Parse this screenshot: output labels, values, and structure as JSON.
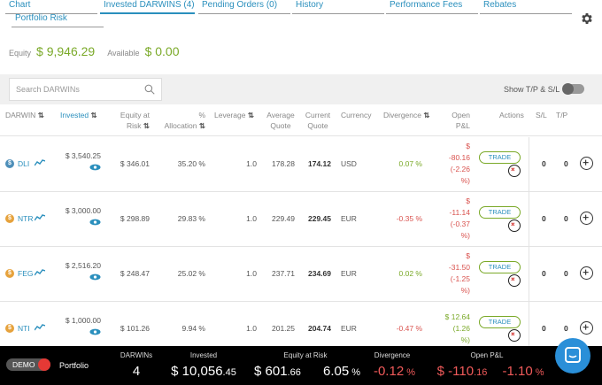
{
  "tabs": [
    {
      "label": "Chart"
    },
    {
      "label": "Invested DARWINS (4)"
    },
    {
      "label": "Pending Orders (0)"
    },
    {
      "label": "History"
    },
    {
      "label": "Performance Fees"
    },
    {
      "label": "Rebates"
    },
    {
      "label": "Portfolio Risk"
    }
  ],
  "active_tab": "Invested DARWINS (4)",
  "summary": {
    "equity_label": "Equity",
    "equity_value": "$ 9,946.29",
    "available_label": "Available",
    "available_value": "$ 0.00"
  },
  "search": {
    "placeholder": "Search DARWINs"
  },
  "show_tp_sl": {
    "label": "Show T/P & S/L",
    "enabled": false
  },
  "columns": {
    "darwin": "DARWIN",
    "invested": "Invested",
    "equity_at_risk_1": "Equity at",
    "equity_at_risk_2": "Risk",
    "alloc_1": "%",
    "alloc_2": "Allocation",
    "leverage": "Leverage",
    "avg_1": "Average",
    "avg_2": "Quote",
    "cur_1": "Current",
    "cur_2": "Quote",
    "currency": "Currency",
    "divergence": "Divergence",
    "pnl_1": "Open",
    "pnl_2": "P&L",
    "actions": "Actions",
    "sl": "S/L",
    "tp": "T/P",
    "sort_icon": "⇅"
  },
  "rows": [
    {
      "darwin": "DLI",
      "coin_color": "#4e8fb9",
      "invested": "$ 3,540.25",
      "equity_at_risk": "$ 346.01",
      "allocation": "35.20 %",
      "leverage": "1.0",
      "average_quote": "178.28",
      "current_quote": "174.12",
      "currency": "USD",
      "divergence": "0.07 %",
      "divergence_sign": "positive",
      "pnl_lines": [
        "$",
        "-80.16",
        "(-2.26",
        "%)"
      ],
      "pnl_sign": "negative",
      "trade_label": "TRADE",
      "sl": "0",
      "tp": "0"
    },
    {
      "darwin": "NTR",
      "coin_color": "#e6a23c",
      "invested": "$ 3,000.00",
      "equity_at_risk": "$ 298.89",
      "allocation": "29.83 %",
      "leverage": "1.0",
      "average_quote": "229.49",
      "current_quote": "229.45",
      "currency": "EUR",
      "divergence": "-0.35 %",
      "divergence_sign": "negative",
      "pnl_lines": [
        "$",
        "-11.14",
        "(-0.37",
        "%)"
      ],
      "pnl_sign": "negative",
      "trade_label": "TRADE",
      "sl": "0",
      "tp": "0"
    },
    {
      "darwin": "FEG",
      "coin_color": "#e6a23c",
      "invested": "$ 2,516.20",
      "equity_at_risk": "$ 248.47",
      "allocation": "25.02 %",
      "leverage": "1.0",
      "average_quote": "237.71",
      "current_quote": "234.69",
      "currency": "EUR",
      "divergence": "0.02 %",
      "divergence_sign": "positive",
      "pnl_lines": [
        "$",
        "-31.50",
        "(-1.25",
        "%)"
      ],
      "pnl_sign": "negative",
      "trade_label": "TRADE",
      "sl": "0",
      "tp": "0"
    },
    {
      "darwin": "NTI",
      "coin_color": "#e6a23c",
      "invested": "$ 1,000.00",
      "equity_at_risk": "$ 101.26",
      "allocation": "9.94 %",
      "leverage": "1.0",
      "average_quote": "201.25",
      "current_quote": "204.74",
      "currency": "EUR",
      "divergence": "-0.47 %",
      "divergence_sign": "negative",
      "pnl_lines": [
        "$ 12.64",
        "(1.26",
        "%)"
      ],
      "pnl_sign": "positive",
      "trade_label": "TRADE",
      "sl": "0",
      "tp": "0"
    }
  ],
  "footer": {
    "demo_label": "DEMO",
    "portfolio_label": "Portfolio",
    "darwins_label": "DARWINs",
    "darwins_value": "4",
    "invested_label": "Invested",
    "invested_main": "$ 10,056",
    "invested_cents": ".45",
    "ear_label": "Equity at Risk",
    "ear_main": "$ 601",
    "ear_cents": ".66",
    "ear_pct_main": "6.05",
    "ear_pct_sign": " %",
    "div_label": "Divergence",
    "div_main": "-0.12",
    "div_sign": " %",
    "pnl_label": "Open P&L",
    "pnl_main": "$ -110",
    "pnl_cents": ".16",
    "pnl_pct_main": "-1.10",
    "pnl_pct_sign": " %"
  },
  "colors": {
    "accent_blue": "#2a8fbd",
    "green": "#7aa928",
    "red": "#d9534f",
    "chat_button": "#2a8fd8"
  }
}
